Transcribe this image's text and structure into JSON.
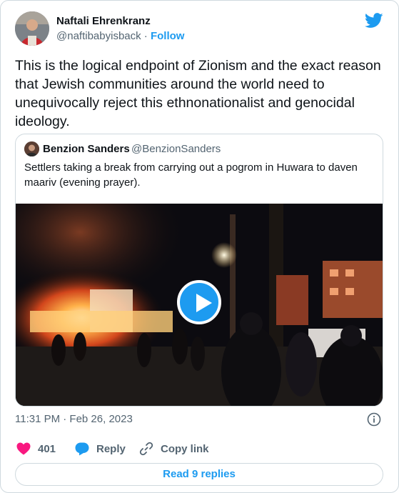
{
  "author": {
    "name": "Naftali Ehrenkranz",
    "handle": "@naftibabyisback",
    "separator": "·",
    "follow_label": "Follow"
  },
  "tweet": {
    "text": "This is the logical endpoint of Zionism and the exact reason that Jewish communities around the world need to unequivocally reject this ethnonationalist and genocidal ideology."
  },
  "quoted_tweet": {
    "name": "Benzion Sanders",
    "handle": "@BenzionSanders",
    "text": "Settlers taking a break from carrying out a pogrom in Huwara to daven maariv (evening prayer)."
  },
  "timestamp": "11:31 PM · Feb 26, 2023",
  "actions": {
    "like_count": "401",
    "reply_label": "Reply",
    "copy_link_label": "Copy link"
  },
  "read_replies_label": "Read 9 replies",
  "colors": {
    "accent": "#1d9bf0",
    "like": "#f91880",
    "muted": "#536471",
    "text": "#0f1419"
  },
  "icons": [
    "twitter-bird-icon",
    "info-icon",
    "heart-icon",
    "reply-bubble-icon",
    "link-icon",
    "play-icon"
  ]
}
